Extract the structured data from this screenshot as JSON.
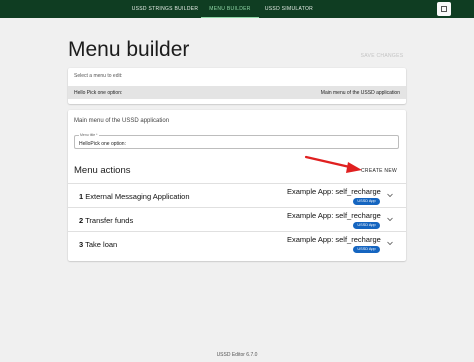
{
  "nav": {
    "tabs": [
      {
        "label": "USSD STRINGS BUILDER"
      },
      {
        "label": "MENU BUILDER"
      },
      {
        "label": "USSD SIMULATOR"
      }
    ],
    "active_tab": "MENU BUILDER",
    "accent": "#0f3d22"
  },
  "header": {
    "title": "Menu builder",
    "save_label": "SAVE CHANGES"
  },
  "menu_select": {
    "label": "Select a menu to edit:",
    "selected_left": "Hello Pick one option:",
    "selected_right": "Main menu of the USSD application"
  },
  "editor": {
    "heading": "Main menu of the USSD application",
    "menu_title_label": "Menu title *",
    "menu_title_value": "HelloPick one option:",
    "actions_title": "Menu actions",
    "create_label": "CREATE NEW",
    "actions": [
      {
        "number": "1",
        "name": "External Messaging Application",
        "app": "Example App: self_recharge",
        "badge": "USSD App"
      },
      {
        "number": "2",
        "name": "Transfer funds",
        "app": "Example App: self_recharge",
        "badge": "USSD App"
      },
      {
        "number": "3",
        "name": "Take loan",
        "app": "Example App: self_recharge",
        "badge": "USSD App"
      }
    ],
    "badge_color": "#1565c0",
    "arrow_color": "#e02020"
  },
  "footer": {
    "version": "USSD Editor 6.7.0"
  }
}
